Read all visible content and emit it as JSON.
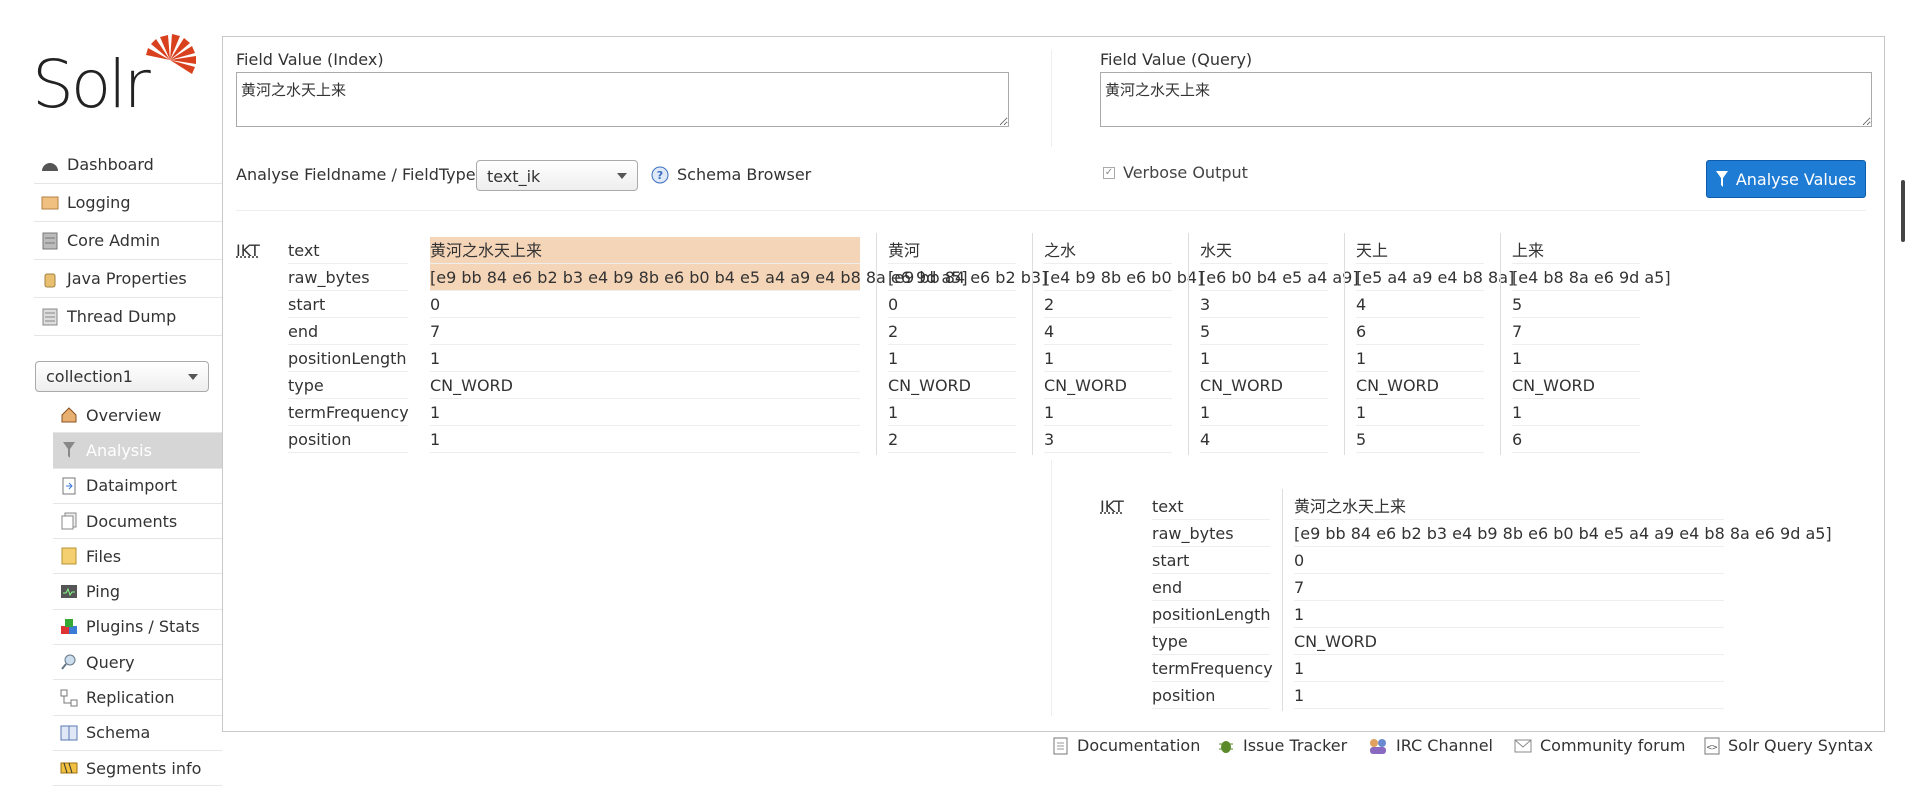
{
  "app": {
    "logo_text": "Solr"
  },
  "nav": {
    "main": [
      {
        "label": "Dashboard",
        "icon": "dashboard-icon"
      },
      {
        "label": "Logging",
        "icon": "logging-icon"
      },
      {
        "label": "Core Admin",
        "icon": "core-admin-icon"
      },
      {
        "label": "Java Properties",
        "icon": "java-icon"
      },
      {
        "label": "Thread Dump",
        "icon": "thread-dump-icon"
      }
    ],
    "core_selector": "collection1",
    "core": [
      {
        "label": "Overview",
        "icon": "home-icon"
      },
      {
        "label": "Analysis",
        "icon": "funnel-icon",
        "active": true
      },
      {
        "label": "Dataimport",
        "icon": "dataimport-icon"
      },
      {
        "label": "Documents",
        "icon": "documents-icon"
      },
      {
        "label": "Files",
        "icon": "folder-icon"
      },
      {
        "label": "Ping",
        "icon": "ping-icon"
      },
      {
        "label": "Plugins / Stats",
        "icon": "plugins-icon"
      },
      {
        "label": "Query",
        "icon": "query-icon"
      },
      {
        "label": "Replication",
        "icon": "replication-icon"
      },
      {
        "label": "Schema",
        "icon": "schema-icon"
      },
      {
        "label": "Segments info",
        "icon": "segments-icon"
      }
    ]
  },
  "analysis": {
    "index_label": "Field Value (Index)",
    "index_value": "黄河之水天上来",
    "query_label": "Field Value (Query)",
    "query_value": "黄河之水天上来",
    "fieldtype_label": "Analyse Fieldname / FieldType:",
    "fieldtype_value": "text_ik",
    "schema_browser": "Schema Browser",
    "verbose_label": "Verbose Output",
    "verbose_checked": true,
    "analyse_button": "Analyse Values"
  },
  "index_result": {
    "tokenizer": "IKT",
    "keys": [
      "text",
      "raw_bytes",
      "start",
      "end",
      "positionLength",
      "type",
      "termFrequency",
      "position"
    ],
    "tokens": [
      [
        "黄河之水天上来",
        "[e9 bb 84 e6 b2 b3 e4 b9 8b e6 b0 b4 e5 a4 a9 e4 b8 8a e6 9d a5]",
        "0",
        "7",
        "1",
        "CN_WORD",
        "1",
        "1"
      ],
      [
        "黄河",
        "[e9 bb 84 e6 b2 b3]",
        "0",
        "2",
        "1",
        "CN_WORD",
        "1",
        "2"
      ],
      [
        "之水",
        "[e4 b9 8b e6 b0 b4]",
        "2",
        "4",
        "1",
        "CN_WORD",
        "1",
        "3"
      ],
      [
        "水天",
        "[e6 b0 b4 e5 a4 a9]",
        "3",
        "5",
        "1",
        "CN_WORD",
        "1",
        "4"
      ],
      [
        "天上",
        "[e5 a4 a9 e4 b8 8a]",
        "4",
        "6",
        "1",
        "CN_WORD",
        "1",
        "5"
      ],
      [
        "上来",
        "[e4 b8 8a e6 9d a5]",
        "5",
        "7",
        "1",
        "CN_WORD",
        "1",
        "6"
      ]
    ]
  },
  "query_result": {
    "tokenizer": "IKT",
    "keys": [
      "text",
      "raw_bytes",
      "start",
      "end",
      "positionLength",
      "type",
      "termFrequency",
      "position"
    ],
    "tokens": [
      [
        "黄河之水天上来",
        "[e9 bb 84 e6 b2 b3 e4 b9 8b e6 b0 b4 e5 a4 a9 e4 b8 8a e6 9d a5]",
        "0",
        "7",
        "1",
        "CN_WORD",
        "1",
        "1"
      ]
    ]
  },
  "footer": [
    {
      "label": "Documentation",
      "icon": "document-icon"
    },
    {
      "label": "Issue Tracker",
      "icon": "bug-icon"
    },
    {
      "label": "IRC Channel",
      "icon": "irc-icon"
    },
    {
      "label": "Community forum",
      "icon": "mail-icon"
    },
    {
      "label": "Solr Query Syntax",
      "icon": "syntax-icon"
    }
  ]
}
